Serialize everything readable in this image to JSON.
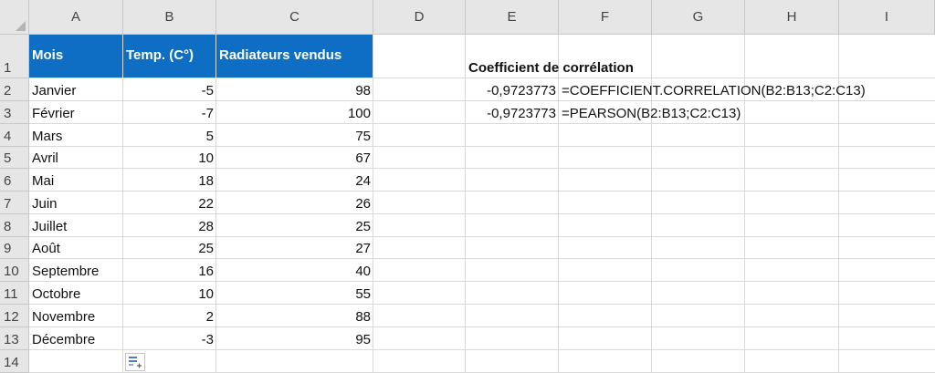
{
  "columns": [
    "A",
    "B",
    "C",
    "D",
    "E",
    "F",
    "G",
    "H",
    "I"
  ],
  "row_numbers": [
    "1",
    "2",
    "3",
    "4",
    "5",
    "6",
    "7",
    "8",
    "9",
    "10",
    "11",
    "12",
    "13",
    "14"
  ],
  "table": {
    "headers": [
      "Mois",
      "Temp. (C°)",
      "Radiateurs vendus"
    ],
    "rows": [
      [
        "Janvier",
        "-5",
        "98"
      ],
      [
        "Février",
        "-7",
        "100"
      ],
      [
        "Mars",
        "5",
        "75"
      ],
      [
        "Avril",
        "10",
        "67"
      ],
      [
        "Mai",
        "18",
        "24"
      ],
      [
        "Juin",
        "22",
        "26"
      ],
      [
        "Juillet",
        "28",
        "25"
      ],
      [
        "Août",
        "25",
        "27"
      ],
      [
        "Septembre",
        "16",
        "40"
      ],
      [
        "Octobre",
        "10",
        "55"
      ],
      [
        "Novembre",
        "2",
        "88"
      ],
      [
        "Décembre",
        "-3",
        "95"
      ]
    ]
  },
  "correlation": {
    "title": "Coefficient de corrélation",
    "rows": [
      {
        "value": "-0,9723773",
        "formula": "=COEFFICIENT.CORRELATION(B2:B13;C2:C13)"
      },
      {
        "value": "-0,9723773",
        "formula": "=PEARSON(B2:B13;C2:C13)"
      }
    ]
  },
  "colors": {
    "table_header_fill": "#0d6ec4",
    "header_background": "#e6e6e6",
    "gridline": "#dadada"
  },
  "icons": {
    "quick_analysis": "quick-analysis-icon"
  }
}
